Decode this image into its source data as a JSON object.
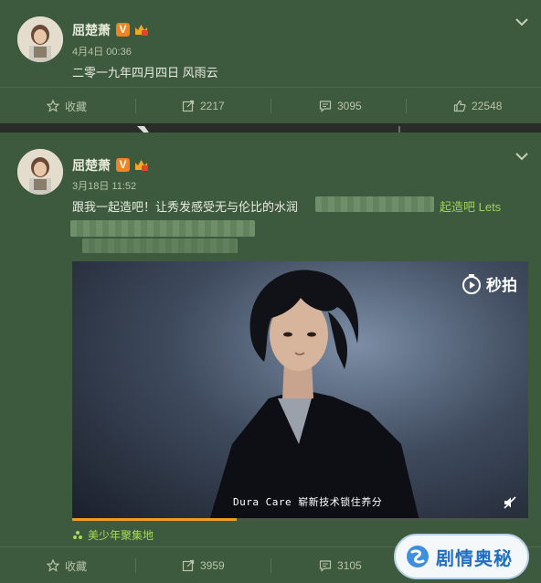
{
  "posts": [
    {
      "author": "屈楚萧",
      "verified_badge": "V",
      "time": "4月4日 00:36",
      "text": "二零一九年四月四日 风雨云",
      "actions": {
        "favorite": "收藏",
        "repost": "2217",
        "comment": "3095",
        "like": "22548"
      }
    },
    {
      "author": "屈楚萧",
      "verified_badge": "V",
      "time": "3月18日 11:52",
      "text": "跟我一起造吧！让秀发感受无与伦比的水润",
      "link_text": "起造吧 Lets",
      "video": {
        "logo_text": "秒拍",
        "subtitle": "Dura Care 崭新技术锁住养分",
        "progress": 0.36
      },
      "source": "美少年聚集地",
      "actions": {
        "favorite": "收藏",
        "repost": "3959",
        "comment": "3105"
      }
    }
  ],
  "watermark": "剧情奥秘",
  "colors": {
    "card_bg": "#3e5a3e",
    "accent_link": "#9ed15a",
    "verified": "#f28322"
  },
  "icons": [
    "star-icon",
    "repost-icon",
    "comment-icon",
    "like-icon",
    "chevron-down-icon",
    "miaopai-logo-icon",
    "mute-icon",
    "source-icon"
  ]
}
